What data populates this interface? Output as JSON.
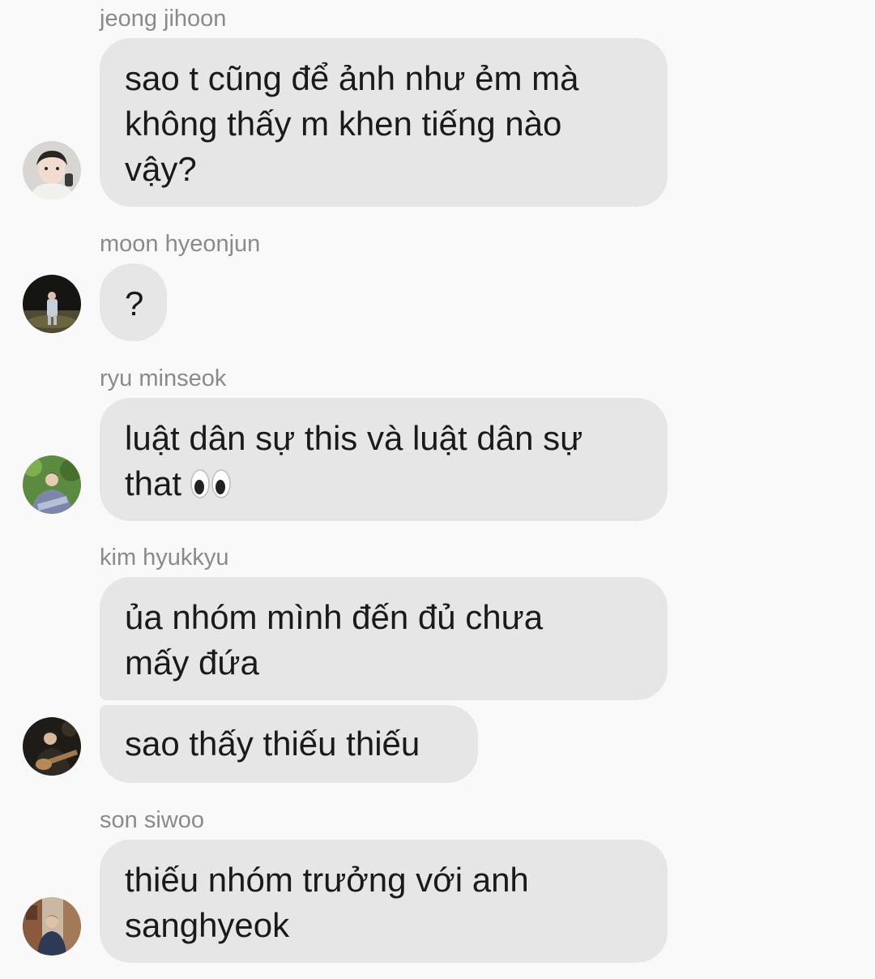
{
  "messages": [
    {
      "sender": "jeong jihoon",
      "bubbles": [
        {
          "text": "sao t cũng để ảnh như ẻm mà\nkhông thấy m khen tiếng nào\nvậy?"
        }
      ]
    },
    {
      "sender": "moon hyeonjun",
      "bubbles": [
        {
          "text": "?"
        }
      ]
    },
    {
      "sender": "ryu minseok",
      "bubbles": [
        {
          "text": "luật dân sự this và luật dân sự\nthat",
          "emoji": "eyes-emoji"
        }
      ]
    },
    {
      "sender": "kim hyukkyu",
      "bubbles": [
        {
          "text": "ủa nhóm mình đến đủ chưa\nmấy đứa"
        },
        {
          "text": "sao thấy thiếu thiếu"
        }
      ]
    },
    {
      "sender": "son siwoo",
      "bubbles": [
        {
          "text": "thiếu nhóm trưởng với anh\nsanghyeok"
        }
      ]
    }
  ],
  "colors": {
    "background": "#f9f9f9",
    "bubble": "#e6e6e6",
    "sender_text": "#8a8a8a",
    "message_text": "#1a1a1a"
  }
}
